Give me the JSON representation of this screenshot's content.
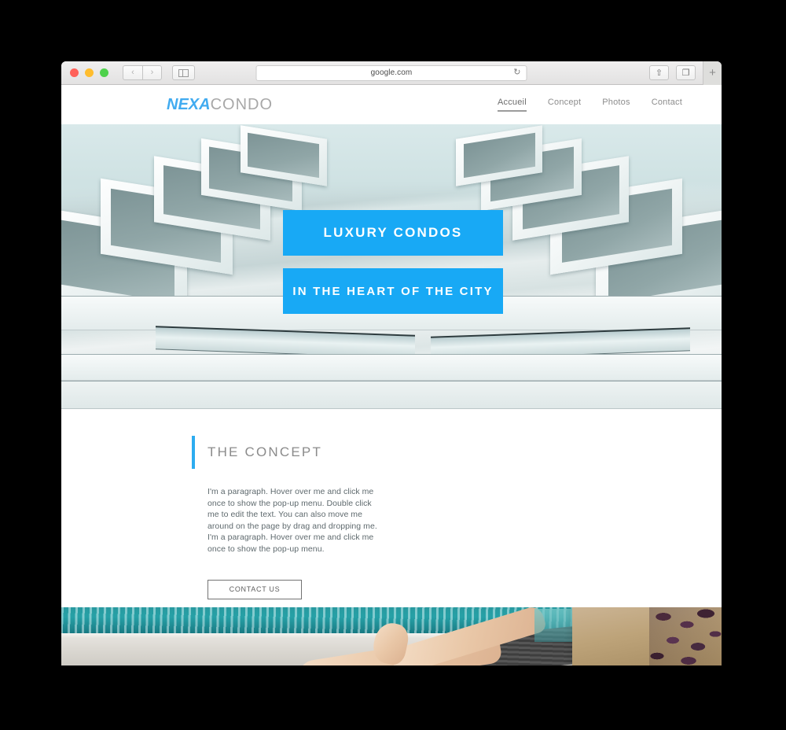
{
  "browser": {
    "url": "google.com",
    "traffic_lights": [
      "close",
      "minimize",
      "maximize"
    ],
    "back_glyph": "‹",
    "forward_glyph": "›",
    "reload_glyph": "↻",
    "share_glyph": "⇧",
    "tabs_glyph": "❐",
    "newtab_glyph": "+",
    "accent_blue": "#18a9f5"
  },
  "site": {
    "logo": {
      "primary": "NEXA",
      "secondary": "CONDO",
      "primary_color": "#41abf0",
      "secondary_color": "#a8a8a8"
    },
    "nav": [
      {
        "label": "Accueil",
        "active": true
      },
      {
        "label": "Concept",
        "active": false
      },
      {
        "label": "Photos",
        "active": false
      },
      {
        "label": "Contact",
        "active": false
      }
    ],
    "hero": {
      "banner_1": "LUXURY CONDOS",
      "banner_2": "IN THE HEART OF THE CITY",
      "banner_color": "#18a9f5",
      "image_alt": "modern-building-balconies-upward-view"
    },
    "concept": {
      "title": "THE CONCEPT",
      "accent_color": "#2cacf0",
      "paragraph": "I'm a paragraph. Hover over me and click me once to show the pop-up menu. Double click me to edit the text. You can also move me around on the page by drag and dropping me. I'm a paragraph. Hover over me and click me once to show the pop-up menu.",
      "cta_label": "CONTACT US"
    },
    "pool": {
      "image_alt": "poolside-lounger-legs-turquoise-water"
    }
  }
}
